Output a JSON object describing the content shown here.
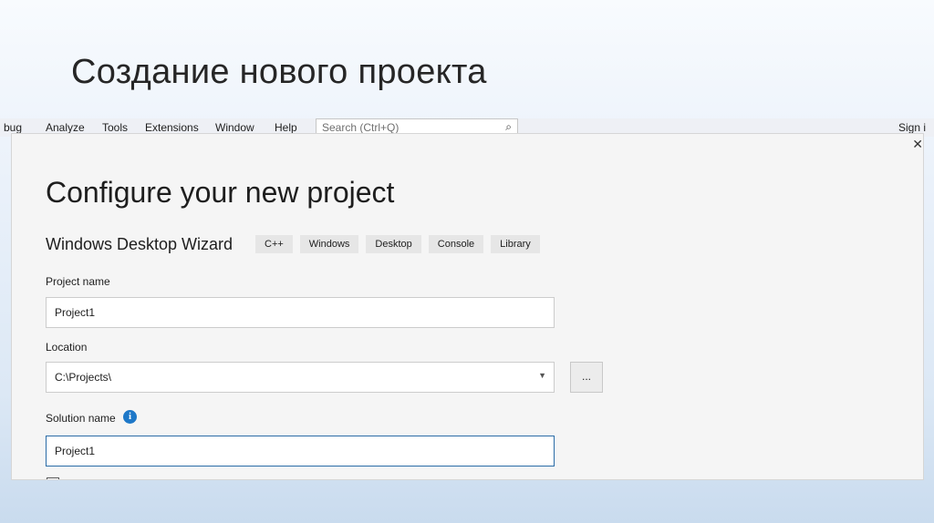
{
  "slide": {
    "title": "Создание нового проекта"
  },
  "menubar": {
    "items": [
      "bug",
      "Analyze",
      "Tools",
      "Extensions",
      "Window",
      "Help"
    ],
    "search_placeholder": "Search (Ctrl+Q)",
    "sign_in": "Sign i"
  },
  "dialog": {
    "heading": "Configure your new project",
    "template_name": "Windows Desktop Wizard",
    "tags": [
      "C++",
      "Windows",
      "Desktop",
      "Console",
      "Library"
    ],
    "project_name": {
      "label": "Project name",
      "value": "Project1"
    },
    "location": {
      "label": "Location",
      "value": "C:\\Projects\\",
      "browse_label": "..."
    },
    "solution_name": {
      "label": "Solution name",
      "value": "Project1"
    }
  },
  "icons": {
    "search": "search-icon",
    "close": "close-icon",
    "info": "info-icon",
    "dropdown": "chevron-down-icon"
  }
}
